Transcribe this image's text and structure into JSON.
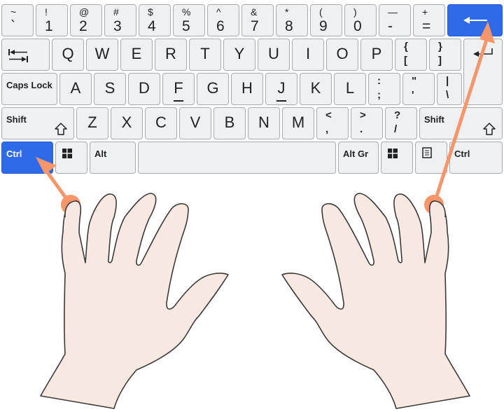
{
  "keyboard": {
    "rows": [
      [
        {
          "top": "~",
          "bottom": "`"
        },
        {
          "top": "!",
          "bottom": "1"
        },
        {
          "top": "@",
          "bottom": "2"
        },
        {
          "top": "#",
          "bottom": "3"
        },
        {
          "top": "$",
          "bottom": "4"
        },
        {
          "top": "%",
          "bottom": "5"
        },
        {
          "top": "^",
          "bottom": "6"
        },
        {
          "top": "&",
          "bottom": "7"
        },
        {
          "top": "*",
          "bottom": "8"
        },
        {
          "top": "(",
          "bottom": "9"
        },
        {
          "top": ")",
          "bottom": "0"
        },
        {
          "top": "—",
          "bottom": "-"
        },
        {
          "top": "+",
          "bottom": "="
        },
        {
          "icon": "backspace-arrow-icon",
          "highlighted": true
        }
      ],
      [
        {
          "icon": "tab-icon"
        },
        {
          "main": "Q"
        },
        {
          "main": "W"
        },
        {
          "main": "E"
        },
        {
          "main": "R"
        },
        {
          "main": "T"
        },
        {
          "main": "Y"
        },
        {
          "main": "U"
        },
        {
          "main": "I"
        },
        {
          "main": "O"
        },
        {
          "main": "P"
        },
        {
          "top": "{",
          "bottom": "[",
          "punct": true
        },
        {
          "top": "}",
          "bottom": "]",
          "punct": true
        },
        {
          "icon": "enter-icon"
        }
      ],
      [
        {
          "label": "Caps Lock"
        },
        {
          "main": "A"
        },
        {
          "main": "S"
        },
        {
          "main": "D"
        },
        {
          "main": "F",
          "bump": true
        },
        {
          "main": "G"
        },
        {
          "main": "H"
        },
        {
          "main": "J",
          "bump": true
        },
        {
          "main": "K"
        },
        {
          "main": "L"
        },
        {
          "top": ":",
          "bottom": ";",
          "punct": true
        },
        {
          "top": "\"",
          "bottom": "'",
          "punct": true
        },
        {
          "top": "|",
          "bottom": "\\",
          "punct": true
        }
      ],
      [
        {
          "label": "Shift",
          "icon": "shift-arrow-icon"
        },
        {
          "main": "Z"
        },
        {
          "main": "X"
        },
        {
          "main": "C"
        },
        {
          "main": "V"
        },
        {
          "main": "B"
        },
        {
          "main": "N"
        },
        {
          "main": "M"
        },
        {
          "top": "<",
          "bottom": ",",
          "punct": true
        },
        {
          "top": ">",
          "bottom": ".",
          "punct": true
        },
        {
          "top": "?",
          "bottom": "/",
          "punct": true
        },
        {
          "label": "Shift",
          "icon": "shift-arrow-icon"
        }
      ],
      [
        {
          "label": "Ctrl",
          "highlighted": true
        },
        {
          "icon": "windows-icon"
        },
        {
          "label": "Alt"
        },
        {
          "label": ""
        },
        {
          "label": "Alt Gr"
        },
        {
          "icon": "windows-icon"
        },
        {
          "icon": "menu-icon"
        },
        {
          "label": "Ctrl"
        }
      ]
    ]
  },
  "colors": {
    "highlight": "#2f6be8",
    "arrow": "#f7956b",
    "skin": "#f7e8e1",
    "key": "#eff0f2"
  }
}
